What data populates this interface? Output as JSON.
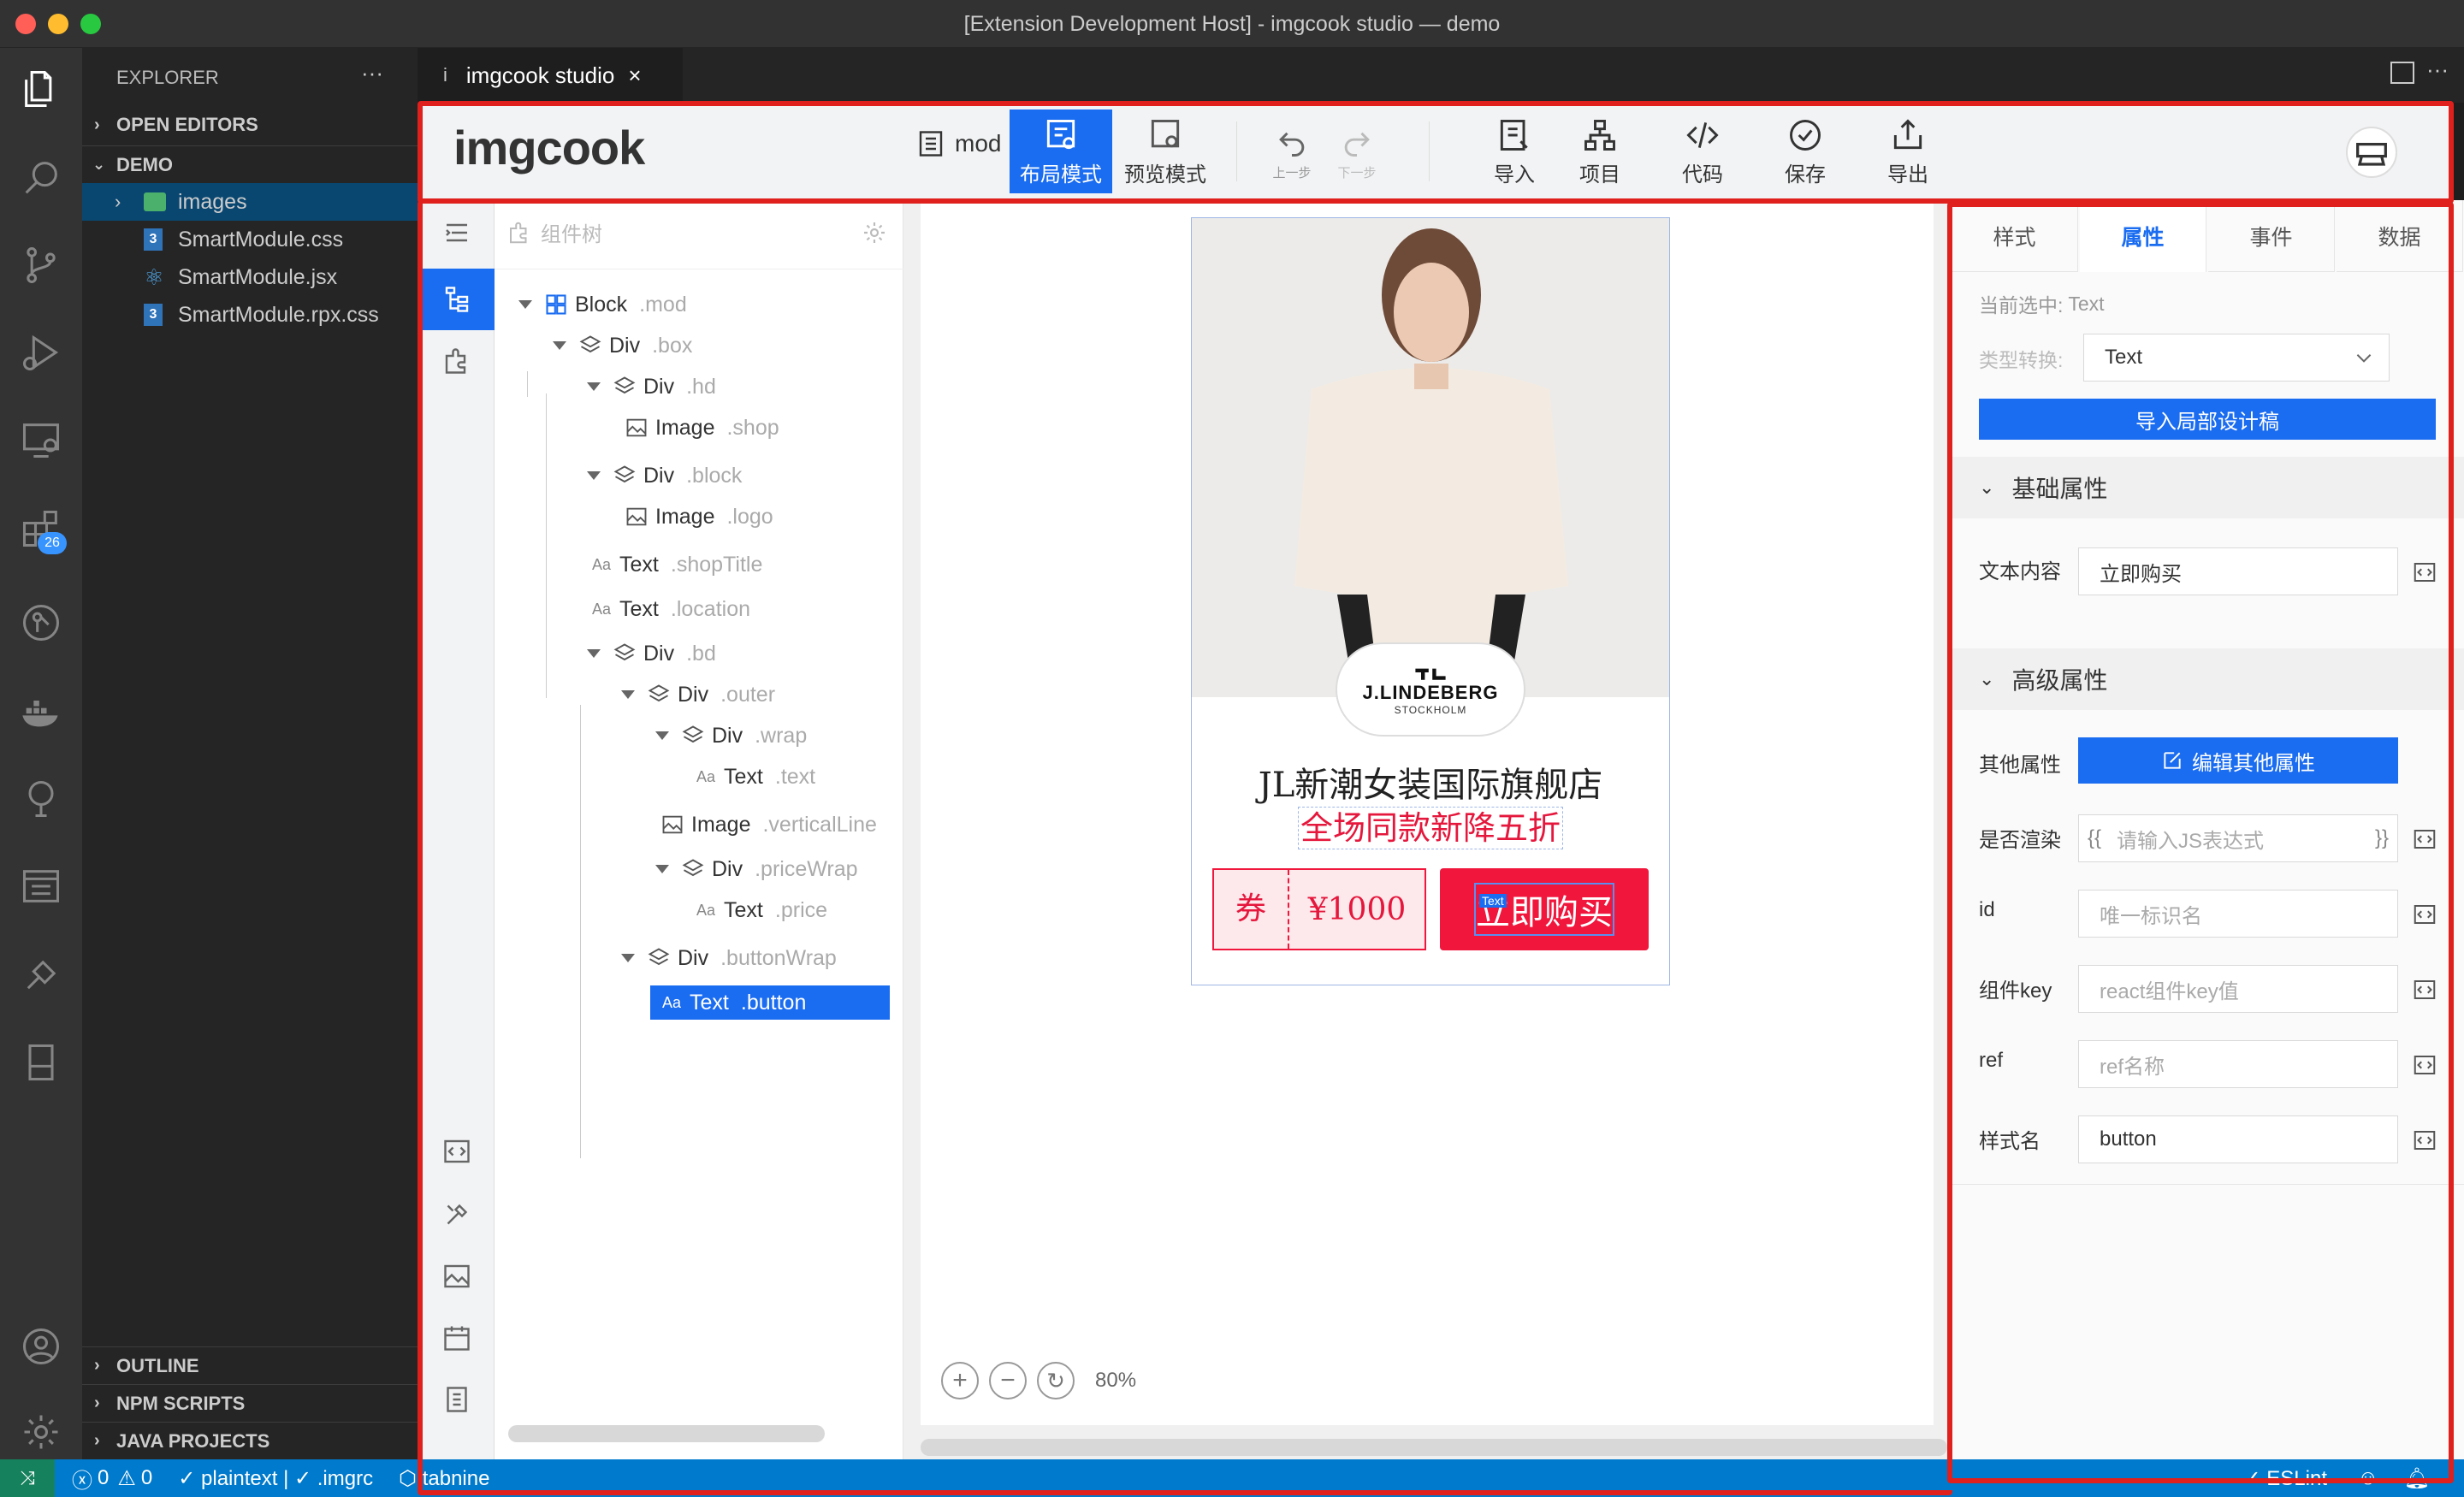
{
  "window": {
    "title": "[Extension Development Host] - imgcook studio — demo"
  },
  "explorer": {
    "title": "EXPLORER",
    "more": "···",
    "open_editors": "OPEN EDITORS",
    "project": "DEMO",
    "files": [
      {
        "name": "images",
        "icon": "image-folder-icon"
      },
      {
        "name": "SmartModule.css",
        "icon": "css-file-icon"
      },
      {
        "name": "SmartModule.jsx",
        "icon": "react-file-icon"
      },
      {
        "name": "SmartModule.rpx.css",
        "icon": "css-file-icon"
      }
    ],
    "outline": "OUTLINE",
    "npm_scripts": "NPM SCRIPTS",
    "java_projects": "JAVA PROJECTS",
    "extensions_badge": "26"
  },
  "editor": {
    "tab_title": "imgcook studio",
    "tab_icon_char": "i",
    "more": "···"
  },
  "toolbar": {
    "logo": "imgcook",
    "module_label": "mod",
    "layout_mode": "布局模式",
    "preview_mode": "预览模式",
    "undo": "上一步",
    "redo": "下一步",
    "import": "导入",
    "project": "项目",
    "code": "代码",
    "save": "保存",
    "export": "导出"
  },
  "tree": {
    "title": "组件树",
    "nodes": [
      {
        "type": "Block",
        "cls": ".mod"
      },
      {
        "type": "Div",
        "cls": ".box"
      },
      {
        "type": "Div",
        "cls": ".hd"
      },
      {
        "type": "Image",
        "cls": ".shop"
      },
      {
        "type": "Div",
        "cls": ".block"
      },
      {
        "type": "Image",
        "cls": ".logo"
      },
      {
        "type": "Text",
        "cls": ".shopTitle"
      },
      {
        "type": "Text",
        "cls": ".location"
      },
      {
        "type": "Div",
        "cls": ".bd"
      },
      {
        "type": "Div",
        "cls": ".outer"
      },
      {
        "type": "Div",
        "cls": ".wrap"
      },
      {
        "type": "Text",
        "cls": ".text"
      },
      {
        "type": "Image",
        "cls": ".verticalLine"
      },
      {
        "type": "Div",
        "cls": ".priceWrap"
      },
      {
        "type": "Text",
        "cls": ".price"
      },
      {
        "type": "Div",
        "cls": ".buttonWrap"
      },
      {
        "type": "Text",
        "cls": ".button"
      }
    ]
  },
  "canvas": {
    "brand": "J.LINDEBERG",
    "brand_sub": "STOCKHOLM",
    "shop_title": "JL新潮女装国际旗舰店",
    "promo": "全场同款新降五折",
    "coupon_label": "券",
    "price": "¥1000",
    "button_text": "立即购买",
    "selection_tag": "Text",
    "zoom": "80%"
  },
  "panel": {
    "tabs": [
      "样式",
      "属性",
      "事件",
      "数据"
    ],
    "current_label": "当前选中:",
    "current_value": "Text",
    "type_convert_label": "类型转换:",
    "type_convert_value": "Text",
    "import_button": "导入局部设计稿",
    "basic_group": "基础属性",
    "text_content_label": "文本内容",
    "text_content_value": "立即购买",
    "advanced_group": "高级属性",
    "other_props_label": "其他属性",
    "other_props_button": "编辑其他属性",
    "render_label": "是否渲染",
    "render_open": "{{",
    "render_placeholder": "请输入JS表达式",
    "render_close": "}}",
    "id_label": "id",
    "id_placeholder": "唯一标识名",
    "key_label": "组件key",
    "key_placeholder": "react组件key值",
    "ref_label": "ref",
    "ref_placeholder": "ref名称",
    "classname_label": "样式名",
    "classname_value": "button"
  },
  "status": {
    "errors": "0",
    "warnings": "0",
    "language": "✓ plaintext | ✓ .imgrc",
    "tabnine": "tabnine",
    "eslint": "ESLint"
  },
  "colors": {
    "accent": "#1a6cf0",
    "status_bar": "#007acc",
    "highlight_red": "#e0201c",
    "buy_button": "#f0163c"
  }
}
